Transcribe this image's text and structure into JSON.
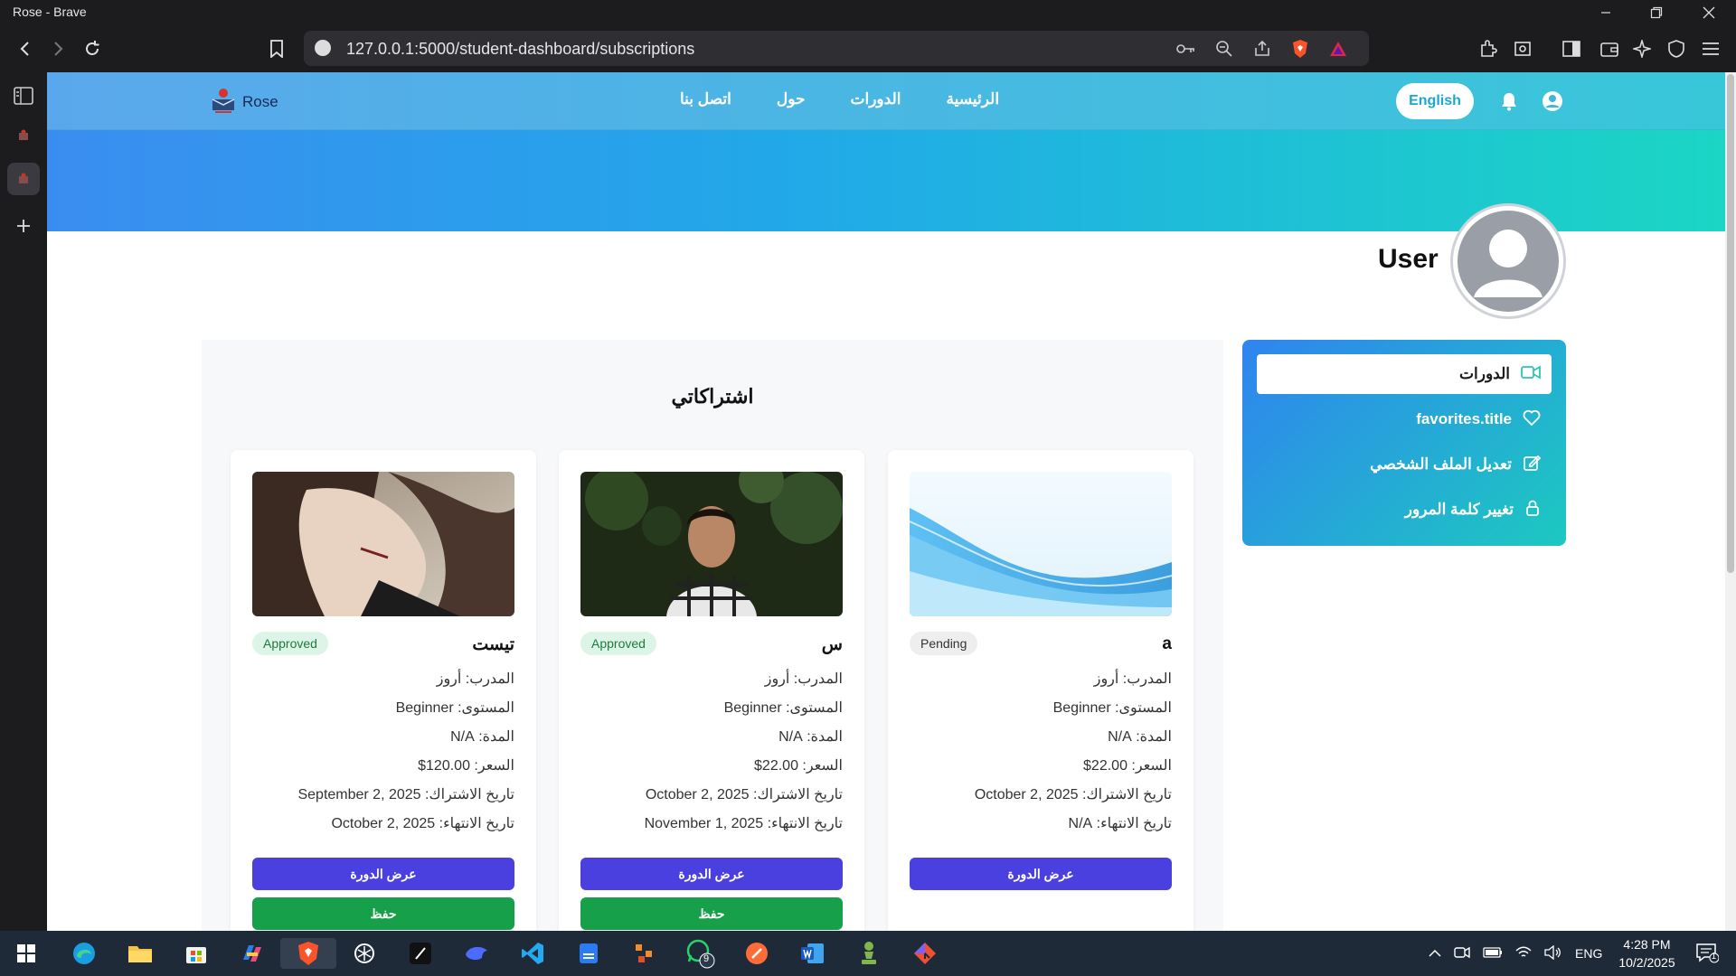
{
  "browser": {
    "window_title": "Rose - Brave",
    "url": "127.0.0.1:5000/student-dashboard/subscriptions"
  },
  "nav": {
    "logo_text": "Rose",
    "links": [
      "الرئيسية",
      "الدورات",
      "حول",
      "اتصل بنا"
    ],
    "language_button": "English"
  },
  "profile": {
    "name": "User"
  },
  "sidebar_menu": {
    "items": [
      {
        "label": "الدورات",
        "icon": "video-icon",
        "active": true
      },
      {
        "label": "favorites.title",
        "icon": "heart-icon",
        "active": false
      },
      {
        "label": "تعديل الملف الشخصي",
        "icon": "edit-icon",
        "active": false
      },
      {
        "label": "تغيير كلمة المرور",
        "icon": "lock-icon",
        "active": false
      }
    ]
  },
  "subscriptions": {
    "title": "اشتراكاتي",
    "cards": [
      {
        "title": "a",
        "status": "Pending",
        "instructor": "المدرب: أروز",
        "level": "المستوى: Beginner",
        "duration": "المدة: N/A",
        "price": "السعر: 22.00$",
        "subscribed": "تاريخ الاشتراك: October 2, 2025",
        "expires": "تاريخ الانتهاء: N/A",
        "view_label": "عرض الدورة",
        "save_label": ""
      },
      {
        "title": "س",
        "status": "Approved",
        "instructor": "المدرب: أروز",
        "level": "المستوى: Beginner",
        "duration": "المدة: N/A",
        "price": "السعر: 22.00$",
        "subscribed": "تاريخ الاشتراك: October 2, 2025",
        "expires": "تاريخ الانتهاء: November 1, 2025",
        "view_label": "عرض الدورة",
        "save_label": "حفظ"
      },
      {
        "title": "تيست",
        "status": "Approved",
        "instructor": "المدرب: أروز",
        "level": "المستوى: Beginner",
        "duration": "المدة: N/A",
        "price": "السعر: 120.00$",
        "subscribed": "تاريخ الاشتراك: September 2, 2025",
        "expires": "تاريخ الانتهاء: October 2, 2025",
        "view_label": "عرض الدورة",
        "save_label": "حفظ"
      }
    ]
  },
  "taskbar": {
    "language": "ENG",
    "time": "4:28 PM",
    "date": "10/2/2025",
    "whatsapp_badge": "9",
    "notification_badge": "1"
  },
  "colors": {
    "primary_button": "#4a40df",
    "save_button": "#17a04a",
    "nav_gradient_start": "#5aa8ec",
    "nav_gradient_end": "#38c7d9"
  }
}
